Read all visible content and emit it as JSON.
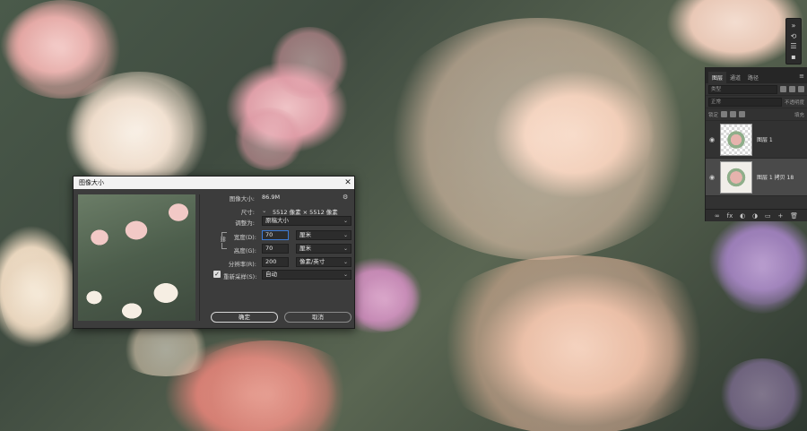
{
  "mini_toolbar": {
    "icons": [
      "expand-icon",
      "history-icon",
      "adjust-icon",
      "comment-icon"
    ]
  },
  "layers_panel": {
    "tabs": [
      {
        "label": "图层",
        "active": true
      },
      {
        "label": "通道",
        "active": false
      },
      {
        "label": "路径",
        "active": false
      }
    ],
    "filter_placeholder": "类型",
    "blend_mode": "正常",
    "opacity_label": "不透明度",
    "lock_label": "锁定",
    "fill_label": "填充",
    "layers": [
      {
        "name": "图层 1",
        "selected": false,
        "transparent": true
      },
      {
        "name": "图层 1 拷贝 18",
        "selected": true,
        "transparent": false
      }
    ],
    "footer_icons": [
      "fx",
      "◐",
      "◑",
      "▭",
      "▢",
      "+",
      "🗑"
    ]
  },
  "dialog": {
    "title": "图像大小",
    "image_size_label": "图像大小:",
    "image_size_value": "86.9M",
    "dimensions_label": "尺寸:",
    "dimensions_value": "5512 像素 × 5512 像素",
    "fit_to_label": "调整为:",
    "fit_to_value": "原稿大小",
    "width_label": "宽度(D):",
    "width_value": "70",
    "width_unit": "厘米",
    "height_label": "高度(G):",
    "height_value": "70",
    "height_unit": "厘米",
    "resolution_label": "分辨率(R):",
    "resolution_value": "200",
    "resolution_unit": "像素/英寸",
    "resample_label": "重新采样(S):",
    "resample_checked": true,
    "resample_value": "自动",
    "ok_label": "确定",
    "cancel_label": "取消"
  }
}
